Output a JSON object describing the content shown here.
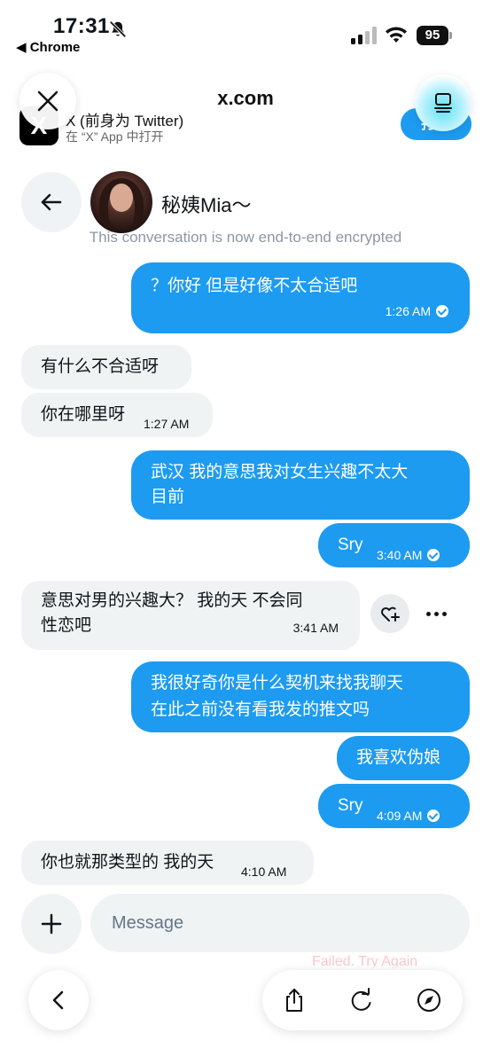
{
  "status_bar": {
    "time": "17:31",
    "back_app": "◀ Chrome",
    "battery": "95"
  },
  "chrome": {
    "url": "x.com",
    "banner_title": "X (前身为 Twitter)",
    "banner_subtitle": "在 “X” App 中打开",
    "open_button": "打开",
    "logo_glyph": "X"
  },
  "conversation": {
    "contact_name": "秘姨Mia～",
    "encryption_notice": "This conversation is now end-to-end encrypted",
    "messages": [
      {
        "dir": "out",
        "text": "？你好 但是好像不太合适吧",
        "time": "1:26 AM",
        "read": true
      },
      {
        "dir": "in",
        "text": "有什么不合适呀",
        "time": ""
      },
      {
        "dir": "in",
        "text": "你在哪里呀",
        "time": "1:27 AM"
      },
      {
        "dir": "out",
        "text": "武汉 我的意思我对女生兴趣不太大目前",
        "line1": "武汉 我的意思我对女生兴趣不太大",
        "line2": "目前",
        "time": ""
      },
      {
        "dir": "out",
        "text": "Sry",
        "time": "3:40 AM",
        "read": true
      },
      {
        "dir": "in",
        "text": "意思对男的兴趣大？ 我的天 不会同性恋吧",
        "line1": "意思对男的兴趣大？ 我的天 不会同",
        "line2": "性恋吧",
        "time": "3:41 AM"
      },
      {
        "dir": "out",
        "text": "我很好奇你是什么契机来找我聊天在此之前没有看我发的推文吗",
        "line1": "我很好奇你是什么契机来找我聊天",
        "line2": "在此之前没有看我发的推文吗",
        "time": ""
      },
      {
        "dir": "out",
        "text": "我喜欢伪娘",
        "time": ""
      },
      {
        "dir": "out",
        "text": "Sry",
        "time": "4:09 AM",
        "read": true
      },
      {
        "dir": "in",
        "text": "你也就那类型的 我的天",
        "time": "4:10 AM"
      }
    ]
  },
  "composer": {
    "placeholder": "Message",
    "failed_text": "Failed. Try Again"
  },
  "icons": {
    "close": "close-icon",
    "tabs": "tabs-icon",
    "back": "arrow-left-icon",
    "react": "heart-plus-icon",
    "more": "more-horizontal-icon",
    "plus": "plus-icon",
    "share": "share-icon",
    "reload": "reload-icon",
    "compass": "compass-icon"
  },
  "colors": {
    "accent": "#1d9bf0",
    "incoming_bubble": "#eff3f4"
  }
}
